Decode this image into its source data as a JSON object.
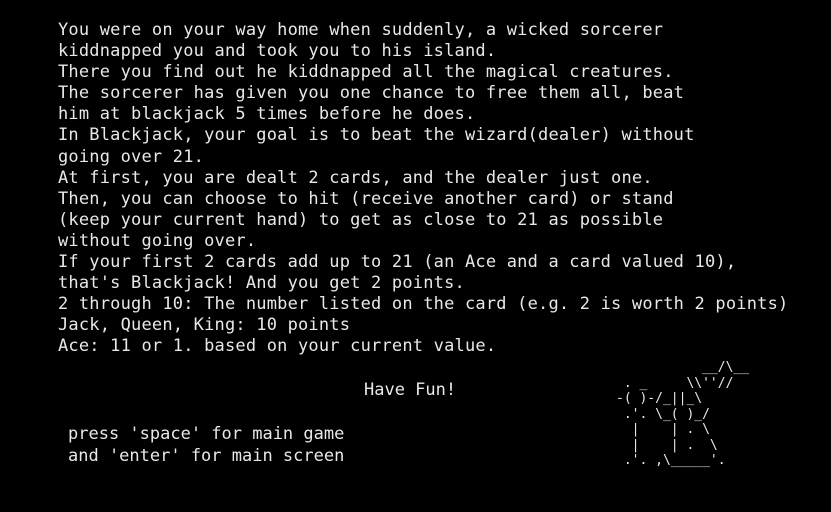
{
  "intro_lines": [
    "You were on your way home when suddenly, a wicked sorcerer",
    "kiddnapped you and took you to his island.",
    "There you find out he kiddnapped all the magical creatures.",
    "The sorcerer has given you one chance to free them all, beat",
    "him at blackjack 5 times before he does.",
    "In Blackjack, your goal is to beat the wizard(dealer) without",
    "going over 21.",
    "At first, you are dealt 2 cards, and the dealer just one.",
    "Then, you can choose to hit (receive another card) or stand",
    "(keep your current hand) to get as close to 21 as possible",
    "without going over.",
    "If your first 2 cards add up to 21 (an Ace and a card valued 10),",
    "that's Blackjack! And you get 2 points.",
    "2 through 10: The number listed on the card (e.g. 2 is worth 2 points)",
    "Jack, Queen, King: 10 points",
    "Ace: 11 or 1. based on your current value."
  ],
  "have_fun": "Have Fun!",
  "controls": {
    "space_hint": "press 'space' for main game",
    "enter_hint": "and 'enter' for main screen"
  },
  "wizard_art": "           __/\\__\n . _     \\\\''//\n-( )-/_||_\\\n .'. \\_( )_/\n  |    | . \\\n  |    | .  \\\n .'. ,\\_____'."
}
